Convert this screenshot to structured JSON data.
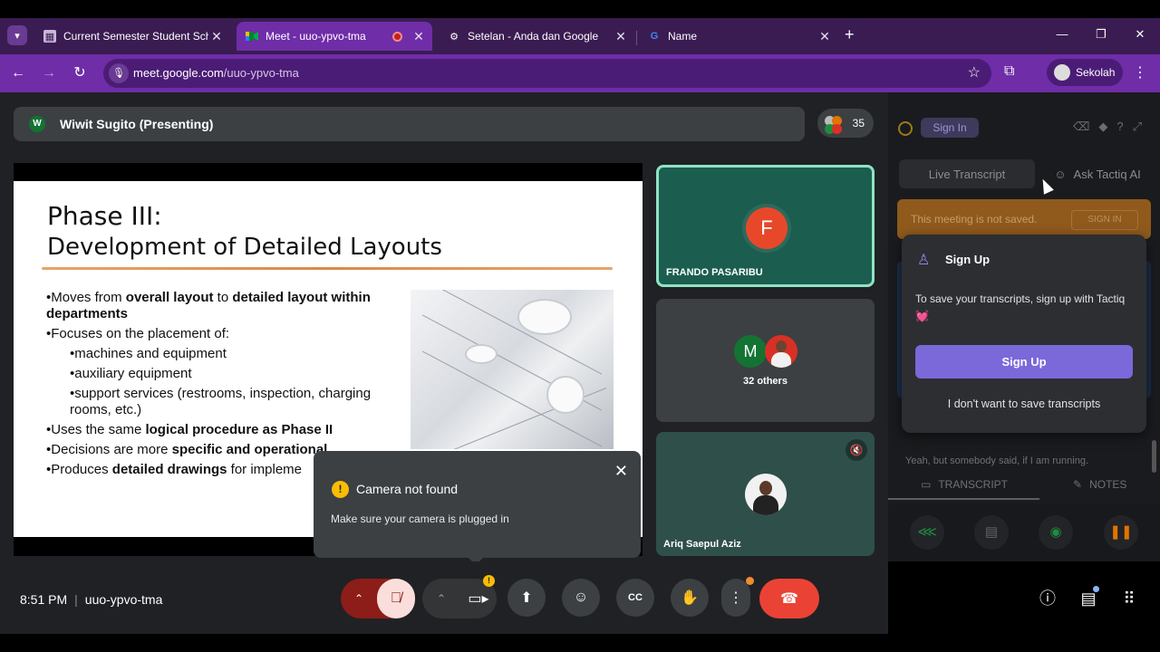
{
  "browser": {
    "tabs": [
      {
        "label": "Current Semester Student Sche",
        "icon": "calendar-icon",
        "active": false
      },
      {
        "label": "Meet - uuo-ypvo-tma",
        "icon": "meet-icon",
        "active": true
      },
      {
        "label": "Setelan - Anda dan Google",
        "icon": "gear-icon",
        "active": false
      },
      {
        "label": "Name",
        "icon": "google-icon",
        "active": false
      }
    ],
    "url_host": "meet.google.com",
    "url_path": "/uuo-ypvo-tma",
    "profile_label": "Sekolah"
  },
  "meet": {
    "presenter": "Wiwit Sugito (Presenting)",
    "presenter_initial": "W",
    "participant_count": "35",
    "slide": {
      "title_line1": "Phase III:",
      "title_line2": "Development of Detailed Layouts",
      "bullets": [
        {
          "html": "•Moves from <b>overall layout</b> to <b>detailed layout within departments</b>",
          "level": 0
        },
        {
          "html": "•Focuses on the placement of:",
          "level": 0
        },
        {
          "html": "•machines and equipment",
          "level": 1
        },
        {
          "html": "•auxiliary equipment",
          "level": 1
        },
        {
          "html": "•support services (restrooms, inspection, charging rooms, etc.)",
          "level": 1
        },
        {
          "html": "•Uses the same <b>logical procedure as Phase II</b>",
          "level": 0
        },
        {
          "html": "•Decisions are more <b>specific and operational</b>",
          "level": 0
        },
        {
          "html": "•Produces <b>detailed drawings</b> for impleme",
          "level": 0
        }
      ]
    },
    "tiles": [
      {
        "name": "FRANDO PASARIBU",
        "initial": "F"
      },
      {
        "name": "32 others",
        "initial": "M"
      },
      {
        "name": "Ariq Saepul Aziz"
      }
    ],
    "toast": {
      "title": "Camera not found",
      "body": "Make sure your camera is plugged in"
    },
    "time": "8:51 PM",
    "meeting_code": "uuo-ypvo-tma"
  },
  "tactiq": {
    "signin": "Sign In",
    "tab_live": "Live Transcript",
    "tab_ask": "Ask Tactiq AI",
    "notice": "This meeting is not saved.",
    "notice_btn": "SIGN IN",
    "dialog": {
      "title": "Sign Up",
      "body": "To save your transcripts, sign up with Tactiq",
      "button": "Sign Up",
      "link": "I don't want to save transcripts"
    },
    "transcript_snippet": "Yeah, but somebody said, if I am running.",
    "bottom_tab_transcript": "TRANSCRIPT",
    "bottom_tab_notes": "NOTES"
  },
  "colors": {
    "chrome_purple": "#6f2da8",
    "meet_bg": "#202124",
    "end_call": "#ea4335",
    "tactiq_accent": "#7b68d9"
  }
}
